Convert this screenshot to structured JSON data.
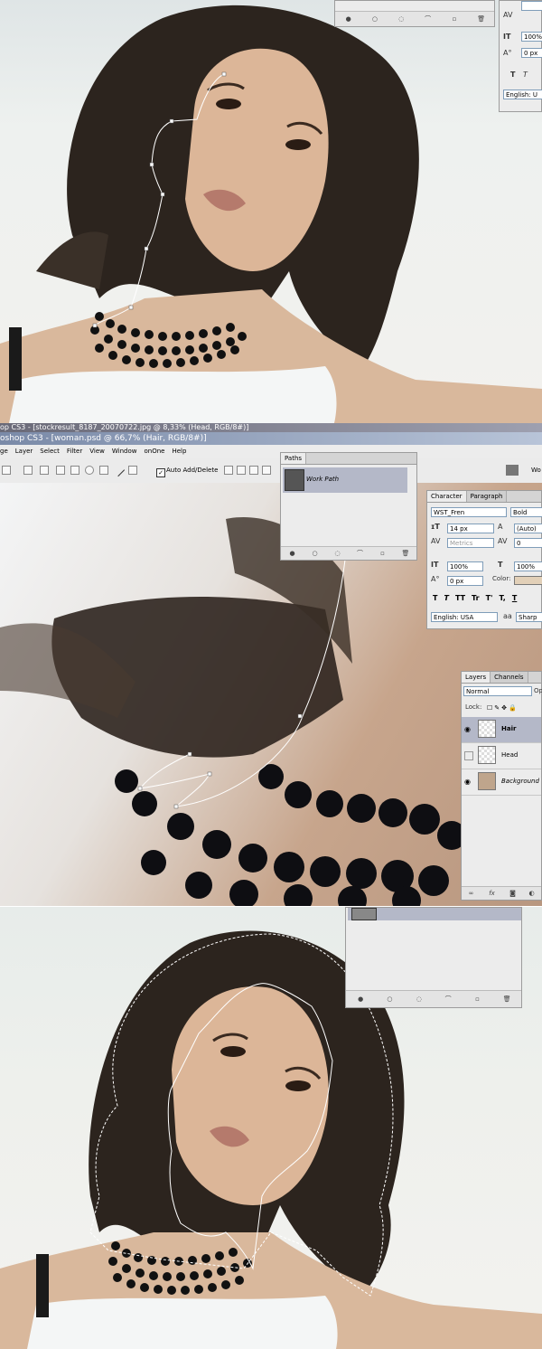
{
  "frame1": {
    "character_panel": {
      "leading_value": "100%",
      "baseline_value": "0 px",
      "language": "English: U"
    }
  },
  "frame2": {
    "window_title": "oshop CS3 - [woman.psd @ 66,7% (Hair, RGB/8#)]",
    "prev_title": "op CS3 - [stockresult_8187_20070722.jpg @ 8,33% (Head, RGB/8#)]",
    "menu": [
      "ge",
      "Layer",
      "Select",
      "Filter",
      "View",
      "Window",
      "onOne",
      "Help"
    ],
    "options_bar": {
      "auto_add_delete_label": "Auto Add/Delete",
      "auto_add_delete_checked": true,
      "right_label": "Wo"
    },
    "paths_panel": {
      "tab": "Paths",
      "paths": [
        "Work Path"
      ]
    },
    "character_panel": {
      "tabs": [
        "Character",
        "Paragraph"
      ],
      "font_family": "WST_Fren",
      "font_style": "Bold",
      "font_size": "14 px",
      "leading": "(Auto)",
      "kerning": "Metrics",
      "tracking": "0",
      "vertical_scale": "100%",
      "horizontal_scale": "100%",
      "baseline_shift": "0 px",
      "color_label": "Color:",
      "color": "#e2d0b8",
      "style_buttons": [
        "T",
        "T",
        "TT",
        "Tr",
        "T'",
        "T,",
        "T"
      ],
      "language": "English: USA",
      "aa_label": "aa",
      "antialias": "Sharp"
    },
    "layers_panel": {
      "tabs": [
        "Layers",
        "Channels"
      ],
      "blend_mode": "Normal",
      "opacity_label": "Op",
      "lock_label": "Lock:",
      "layers": [
        {
          "name": "Hair",
          "visible": true,
          "selected": true
        },
        {
          "name": "Head",
          "visible": false,
          "selected": false
        },
        {
          "name": "Background",
          "visible": true,
          "selected": false
        }
      ],
      "footer_icons": [
        "link-icon",
        "fx",
        "mask-icon",
        "adjustment-icon"
      ]
    }
  },
  "colors": {
    "panel_bg": "#ececec",
    "selected_row": "#b4b8c8",
    "title_bar": "#3a6ea5"
  }
}
